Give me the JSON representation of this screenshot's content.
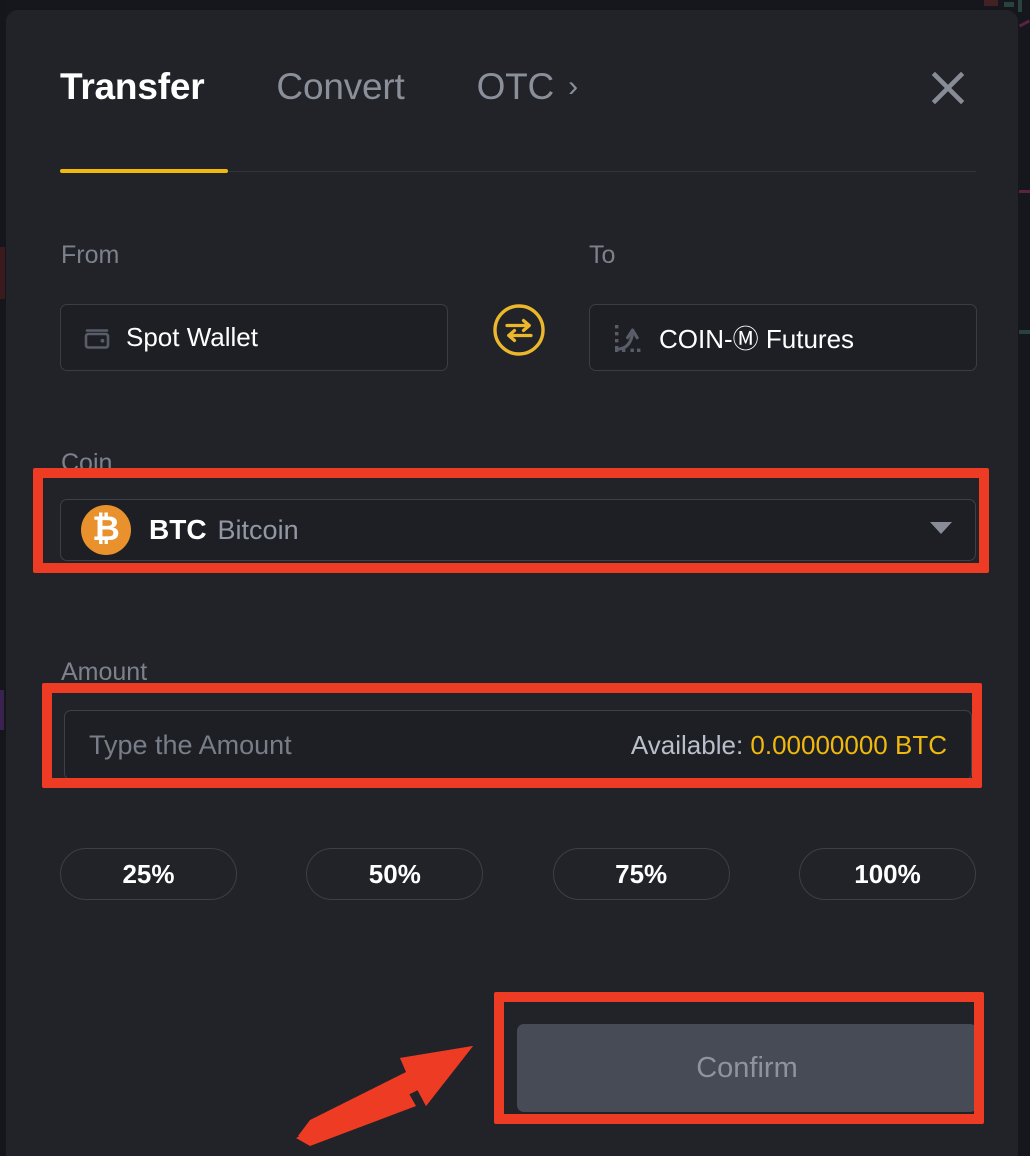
{
  "window": {
    "title": "Transfer"
  },
  "tabs": [
    {
      "label": "Transfer",
      "state": "active"
    },
    {
      "label": "Convert",
      "state": "idle"
    },
    {
      "label": "OTC",
      "state": "idle",
      "chevron": "chevron-right-icon"
    }
  ],
  "close": {
    "icon": "close-icon",
    "label": "Close"
  },
  "transfer": {
    "from": {
      "label": "From",
      "value": "Spot Wallet",
      "icon": "wallet-icon"
    },
    "to": {
      "label": "To",
      "value": "COIN-Ⓜ Futures",
      "icon": "futures-chart-icon"
    },
    "swap": {
      "icon": "swap-arrows-icon",
      "label": "Swap direction"
    },
    "coin": {
      "label": "Coin",
      "symbol": "BTC",
      "name": "Bitcoin",
      "coin_icon": "bitcoin-icon",
      "coin_glyph": "₿",
      "caret": "caret-down-icon"
    },
    "amount": {
      "label": "Amount",
      "value": "",
      "placeholder": "Type the Amount",
      "available_label": "Available:",
      "available_value": "0.00000000 BTC"
    },
    "percent_buttons": [
      {
        "label": "25%"
      },
      {
        "label": "50%"
      },
      {
        "label": "75%"
      },
      {
        "label": "100%"
      }
    ],
    "confirm": {
      "label": "Confirm",
      "disabled": true
    }
  },
  "annotations": {
    "highlight_color": "#ee3b24",
    "highlighted": [
      "coin-selector",
      "amount-input",
      "confirm-button"
    ],
    "arrow": {
      "points_to": "confirm-button",
      "color": "#ee3b24"
    }
  },
  "theme": {
    "modal_bg": "#212329",
    "page_bg": "#15171c",
    "field_bg": "#1d1f25",
    "accent_yellow": "#f0b90b",
    "bitcoin_orange": "#e8912d",
    "disabled_button": "#474b55",
    "muted_text": "#7d818c"
  }
}
